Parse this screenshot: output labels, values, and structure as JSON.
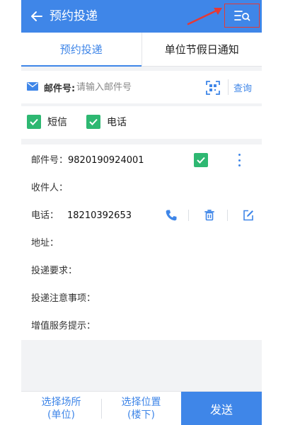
{
  "header": {
    "title": "预约投递",
    "back_icon": "arrow-left-icon",
    "filter_icon": "list-search-icon",
    "background": "#3f86e8",
    "highlight_color": "#e53935"
  },
  "tabs": [
    {
      "label": "预约投递",
      "active": true
    },
    {
      "label": "单位节假日通知",
      "active": false
    }
  ],
  "search": {
    "label": "邮件号:",
    "placeholder": "请输入邮件号",
    "value": "",
    "query_label": "查询",
    "icons": [
      "mail-icon",
      "scan-icon"
    ]
  },
  "notify_options": [
    {
      "label": "短信",
      "checked": true
    },
    {
      "label": "电话",
      "checked": true
    }
  ],
  "mail_card": {
    "mail_no_label": "邮件号：",
    "mail_no": "9820190924001",
    "checked": true,
    "recipient_label": "收件人：",
    "recipient": "",
    "phone_label": "电话：",
    "phone": "18210392653",
    "address_label": "地址：",
    "address": "",
    "requirement_label": "投递要求：",
    "requirement": "",
    "notes_label": "投递注意事项：",
    "notes": "",
    "value_added_label": "增值服务提示：",
    "value_added": "",
    "icons": [
      "more-vertical-icon",
      "phone-icon",
      "trash-icon",
      "edit-icon"
    ]
  },
  "footer": {
    "select_place_line1": "选择场所",
    "select_place_line2": "(单位)",
    "select_position_line1": "选择位置",
    "select_position_line2": "(楼下)",
    "send_label": "发送"
  },
  "colors": {
    "accent": "#3f86e8",
    "check_green": "#2eb872"
  }
}
